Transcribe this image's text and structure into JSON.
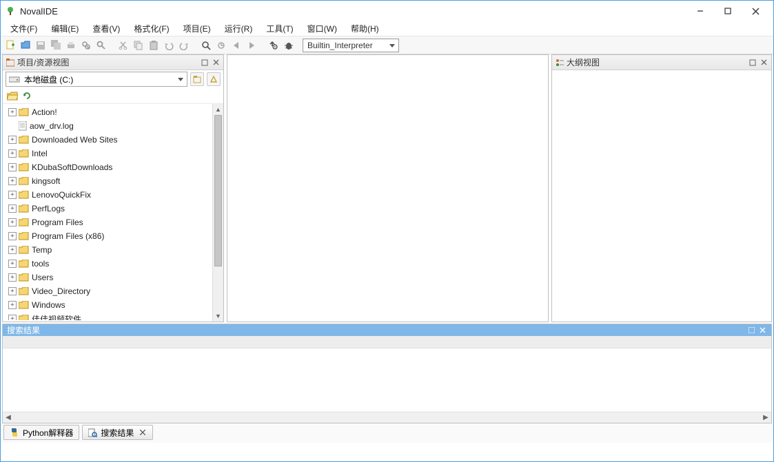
{
  "title": "NovalIDE",
  "menus": [
    "文件(F)",
    "编辑(E)",
    "查看(V)",
    "格式化(F)",
    "项目(E)",
    "运行(R)",
    "工具(T)",
    "窗口(W)",
    "帮助(H)"
  ],
  "interpreter_label": "Builtin_Interpreter",
  "panels": {
    "project_title": "项目/资源视图",
    "outline_title": "大纲视图",
    "search_title": "搜索结果"
  },
  "drive_label": "本地磁盘 (C:)",
  "tree": [
    {
      "type": "folder",
      "label": "Action!",
      "expandable": true
    },
    {
      "type": "file",
      "label": "aow_drv.log",
      "expandable": false
    },
    {
      "type": "folder",
      "label": "Downloaded Web Sites",
      "expandable": true
    },
    {
      "type": "folder",
      "label": "Intel",
      "expandable": true
    },
    {
      "type": "folder",
      "label": "KDubaSoftDownloads",
      "expandable": true
    },
    {
      "type": "folder",
      "label": "kingsoft",
      "expandable": true
    },
    {
      "type": "folder",
      "label": "LenovoQuickFix",
      "expandable": true
    },
    {
      "type": "folder",
      "label": "PerfLogs",
      "expandable": true
    },
    {
      "type": "folder",
      "label": "Program Files",
      "expandable": true
    },
    {
      "type": "folder",
      "label": "Program Files (x86)",
      "expandable": true
    },
    {
      "type": "folder",
      "label": "Temp",
      "expandable": true
    },
    {
      "type": "folder",
      "label": "tools",
      "expandable": true
    },
    {
      "type": "folder",
      "label": "Users",
      "expandable": true
    },
    {
      "type": "folder",
      "label": "Video_Directory",
      "expandable": true
    },
    {
      "type": "folder",
      "label": "Windows",
      "expandable": true
    },
    {
      "type": "folder",
      "label": "佳佳视频软件",
      "expandable": true
    }
  ],
  "bottom_tabs": [
    {
      "label": "Python解释器",
      "closable": false,
      "icon": "python"
    },
    {
      "label": "搜索结果",
      "closable": true,
      "icon": "search"
    }
  ]
}
